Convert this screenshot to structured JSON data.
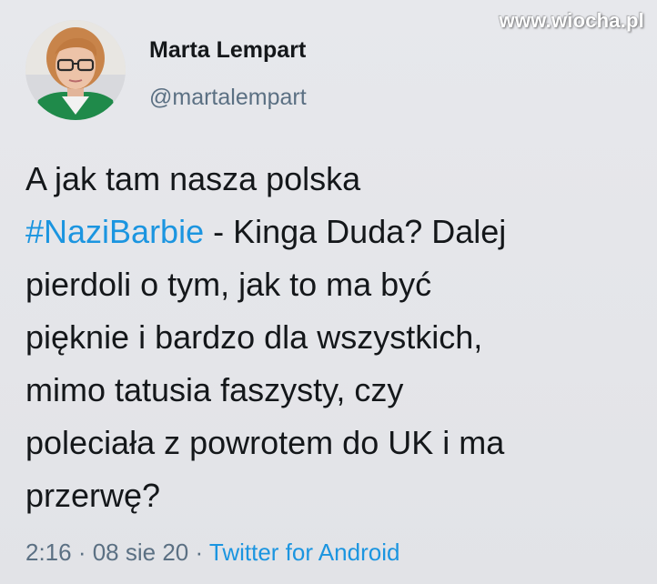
{
  "watermark": "www.wiocha.pl",
  "author": {
    "display_name": "Marta Lempart",
    "handle": "@martalempart"
  },
  "tweet": {
    "line1": "A jak tam nasza polska",
    "hashtag": "#NaziBarbie",
    "line2_rest": " - Kinga Duda? Dalej",
    "line3": "pierdoli o tym, jak to ma być",
    "line4": "pięknie i bardzo dla wszystkich,",
    "line5": "mimo tatusia faszysty, czy",
    "line6": "poleciała z powrotem do UK i ma",
    "line7": "przerwę?"
  },
  "meta": {
    "time": "2:16",
    "separator1": " · ",
    "date": "08 sie 20",
    "separator2": " · ",
    "source": "Twitter for Android"
  },
  "colors": {
    "link": "#1b95e0",
    "secondary": "#5b7083",
    "text": "#14171a",
    "background": "#e4e5e9"
  }
}
